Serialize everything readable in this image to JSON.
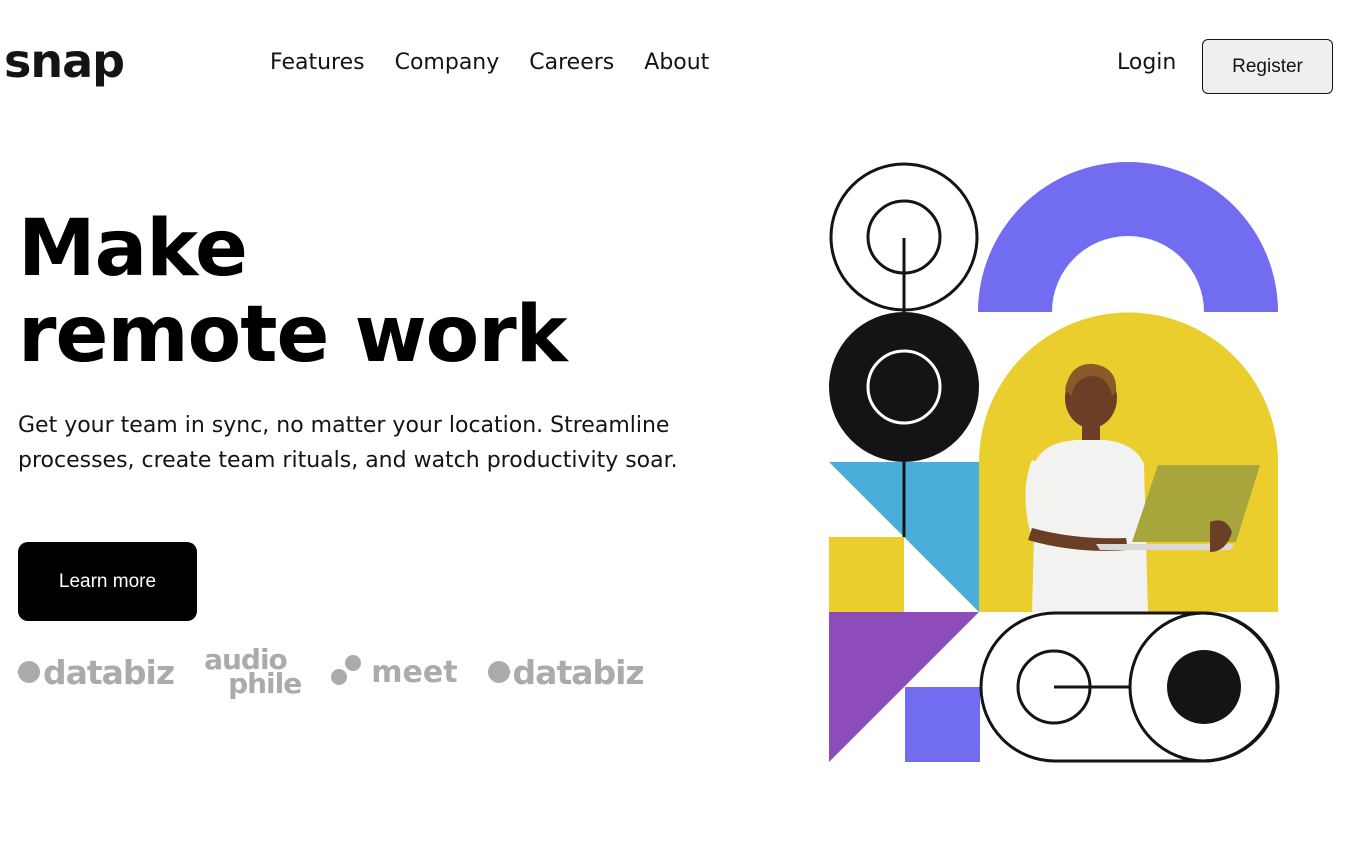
{
  "brand": {
    "logo": "snap"
  },
  "nav": {
    "items": [
      {
        "label": "Features"
      },
      {
        "label": "Company"
      },
      {
        "label": "Careers"
      },
      {
        "label": "About"
      }
    ],
    "login": "Login",
    "register": "Register"
  },
  "hero": {
    "title_line1": "Make",
    "title_line2": "remote work",
    "description": "Get your team in sync, no matter your location. Streamline processes, create team rituals, and watch productivity soar.",
    "cta": "Learn more"
  },
  "clients": {
    "logo1": "databiz",
    "logo2_line1": "audio",
    "logo2_line2": "phile",
    "logo3": "meet",
    "logo4": "databiz"
  },
  "colors": {
    "accent_purple": "#726df0",
    "yellow": "#e9ce2e",
    "blue": "#4aaedb",
    "violet": "#8e4cba",
    "dark": "#141414",
    "logo_gray": "#ababab"
  },
  "icons": {
    "illustration": "geometric-shapes-with-person-using-laptop"
  }
}
